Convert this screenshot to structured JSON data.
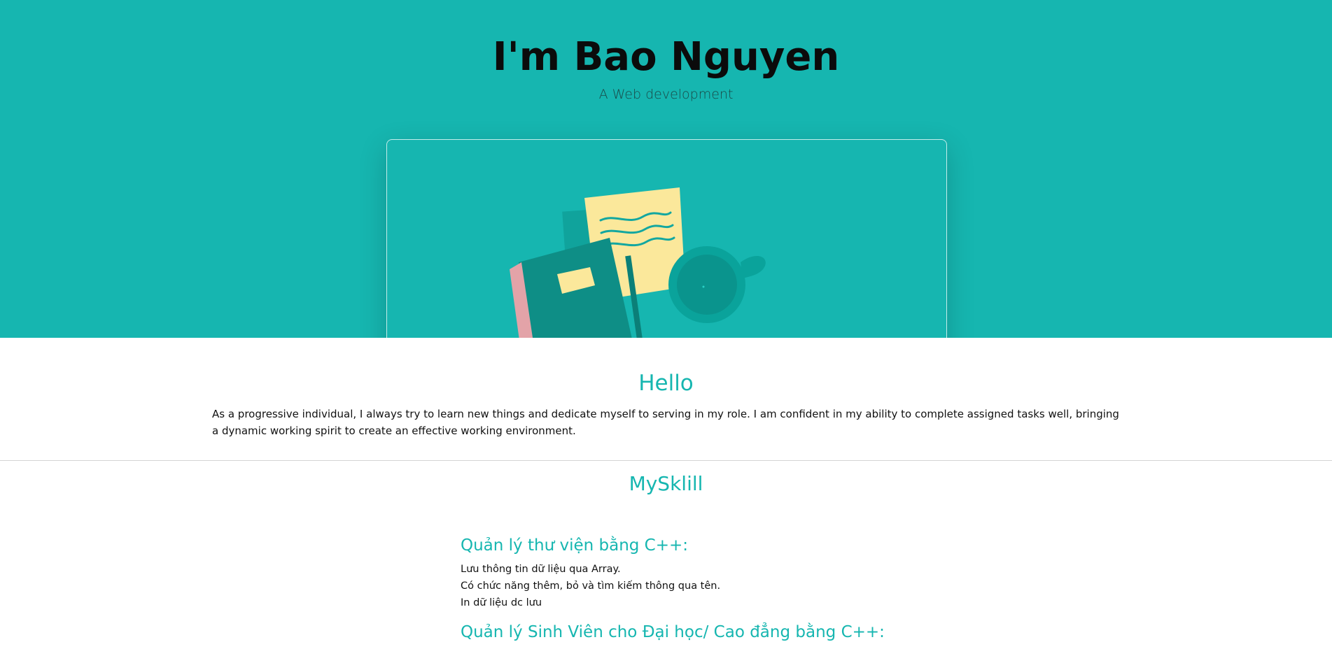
{
  "hero": {
    "title": "I'm Bao Nguyen",
    "subtitle": "A Web development",
    "colors": {
      "background": "#16b6b0",
      "paper": "#fbe89b",
      "book": "#0e8e86",
      "book_spine": "#e3a3a8",
      "cup": "#0a9d95"
    }
  },
  "hello": {
    "title": "Hello",
    "text": "As a progressive individual, I always try to learn new things and dedicate myself to serving in my role. I am confident in my ability to complete assigned tasks well, bringing a dynamic working spirit to create an effective working environment."
  },
  "skills": {
    "title": "MySklill",
    "projects": [
      {
        "title": "Quản lý thư viện bằng C++:",
        "lines": [
          "Lưu thông tin dữ liệu qua Array.",
          "Có chức năng thêm, bỏ và tìm kiếm thông qua tên.",
          "In dữ liệu dc lưu"
        ]
      },
      {
        "title": "Quản lý Sinh Viên cho Đại học/ Cao đẳng bằng C++:",
        "lines": []
      }
    ]
  },
  "accent_color": "#16b6b0"
}
